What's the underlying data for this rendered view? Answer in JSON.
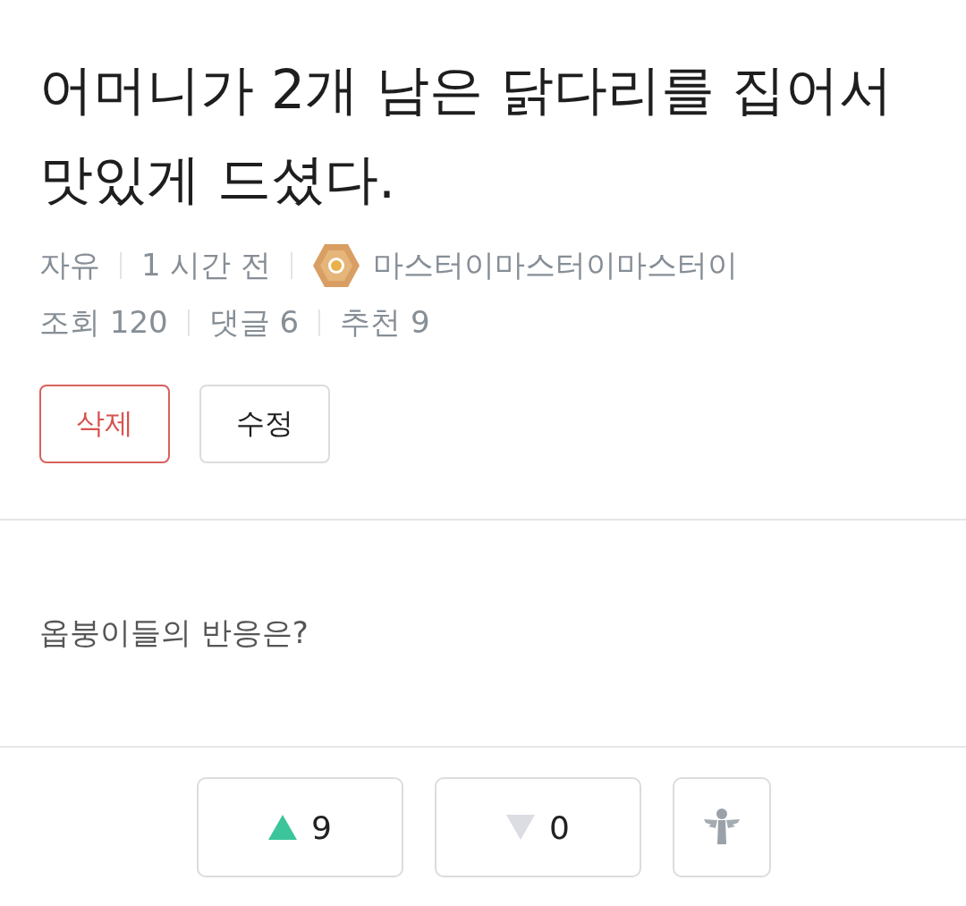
{
  "post": {
    "title": "어머니가 2개 남은 닭다리를 집어서 맛있게 드셨다.",
    "meta": {
      "category": "자유",
      "time": "1 시간 전",
      "author": "마스터이마스터이마스터이",
      "stats": [
        "조회 120",
        "댓글 6",
        "추천 9"
      ]
    },
    "actions": [
      {
        "label": "삭제",
        "kind": "danger"
      },
      {
        "label": "수정",
        "kind": "normal"
      }
    ],
    "body": "옵붕이들의 반응은?",
    "votes": [
      {
        "kind": "up",
        "count": "9"
      },
      {
        "kind": "down",
        "count": "0"
      },
      {
        "kind": "angel"
      }
    ]
  }
}
